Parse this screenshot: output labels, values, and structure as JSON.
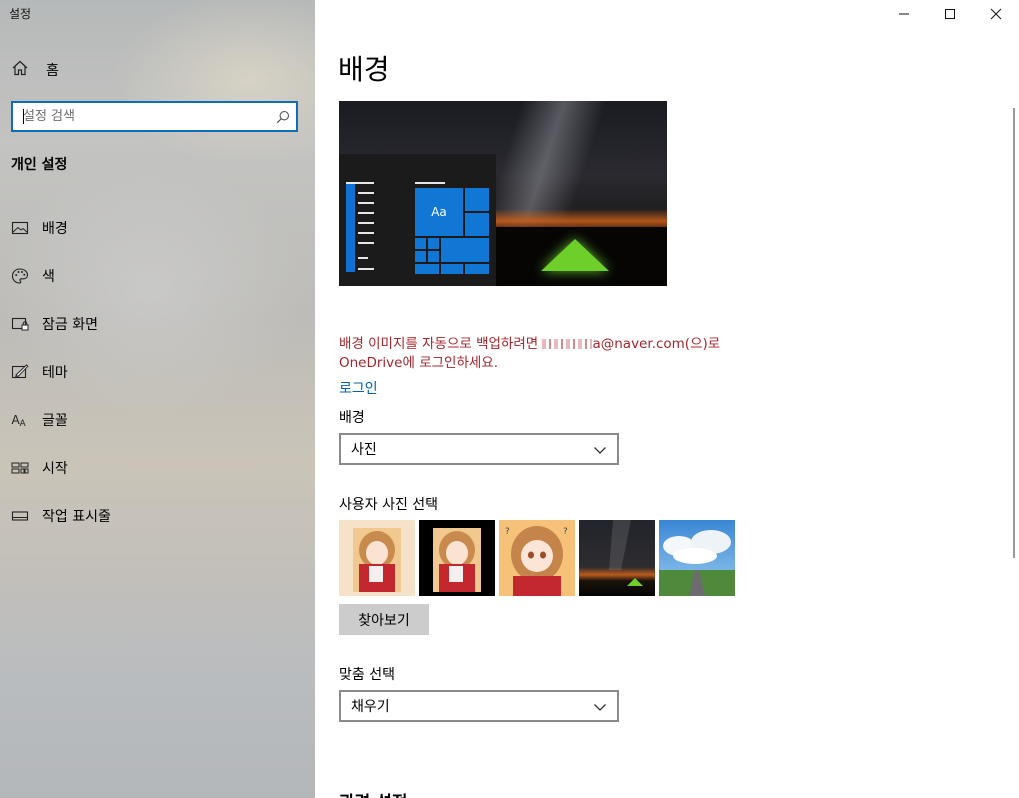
{
  "window": {
    "app_title": "설정",
    "minimize_label": "Minimize",
    "maximize_label": "Maximize",
    "close_label": "Close"
  },
  "sidebar": {
    "home_label": "홈",
    "search_placeholder": "설정 검색",
    "section_title": "개인 설정",
    "items": [
      {
        "label": "배경",
        "icon": "picture-icon",
        "selected": true
      },
      {
        "label": "색",
        "icon": "palette-icon"
      },
      {
        "label": "잠금 화면",
        "icon": "lock-screen-icon"
      },
      {
        "label": "테마",
        "icon": "theme-icon"
      },
      {
        "label": "글꼴",
        "icon": "font-icon"
      },
      {
        "label": "시작",
        "icon": "start-icon"
      },
      {
        "label": "작업 표시줄",
        "icon": "taskbar-icon"
      }
    ]
  },
  "main": {
    "page_title": "배경",
    "preview": {
      "tile_text": "Aa"
    },
    "warning": {
      "line1_prefix": "배경 이미지를 자동으로 백업하려면 ",
      "email_visible": "a@naver.com(으)로",
      "line2": "OneDrive에 로그인하세요."
    },
    "login_link": "로그인",
    "background_label": "배경",
    "background_value": "사진",
    "choose_picture_label": "사용자 사진 선택",
    "browse_button": "찾아보기",
    "fit_label": "맞춤 선택",
    "fit_value": "채우기",
    "next_section_partial": "관련 설정"
  },
  "colors": {
    "accent": "#0078d4",
    "warning": "#a4262c",
    "link": "#0063b1",
    "sidebar_bg": "#bfbfbc"
  }
}
